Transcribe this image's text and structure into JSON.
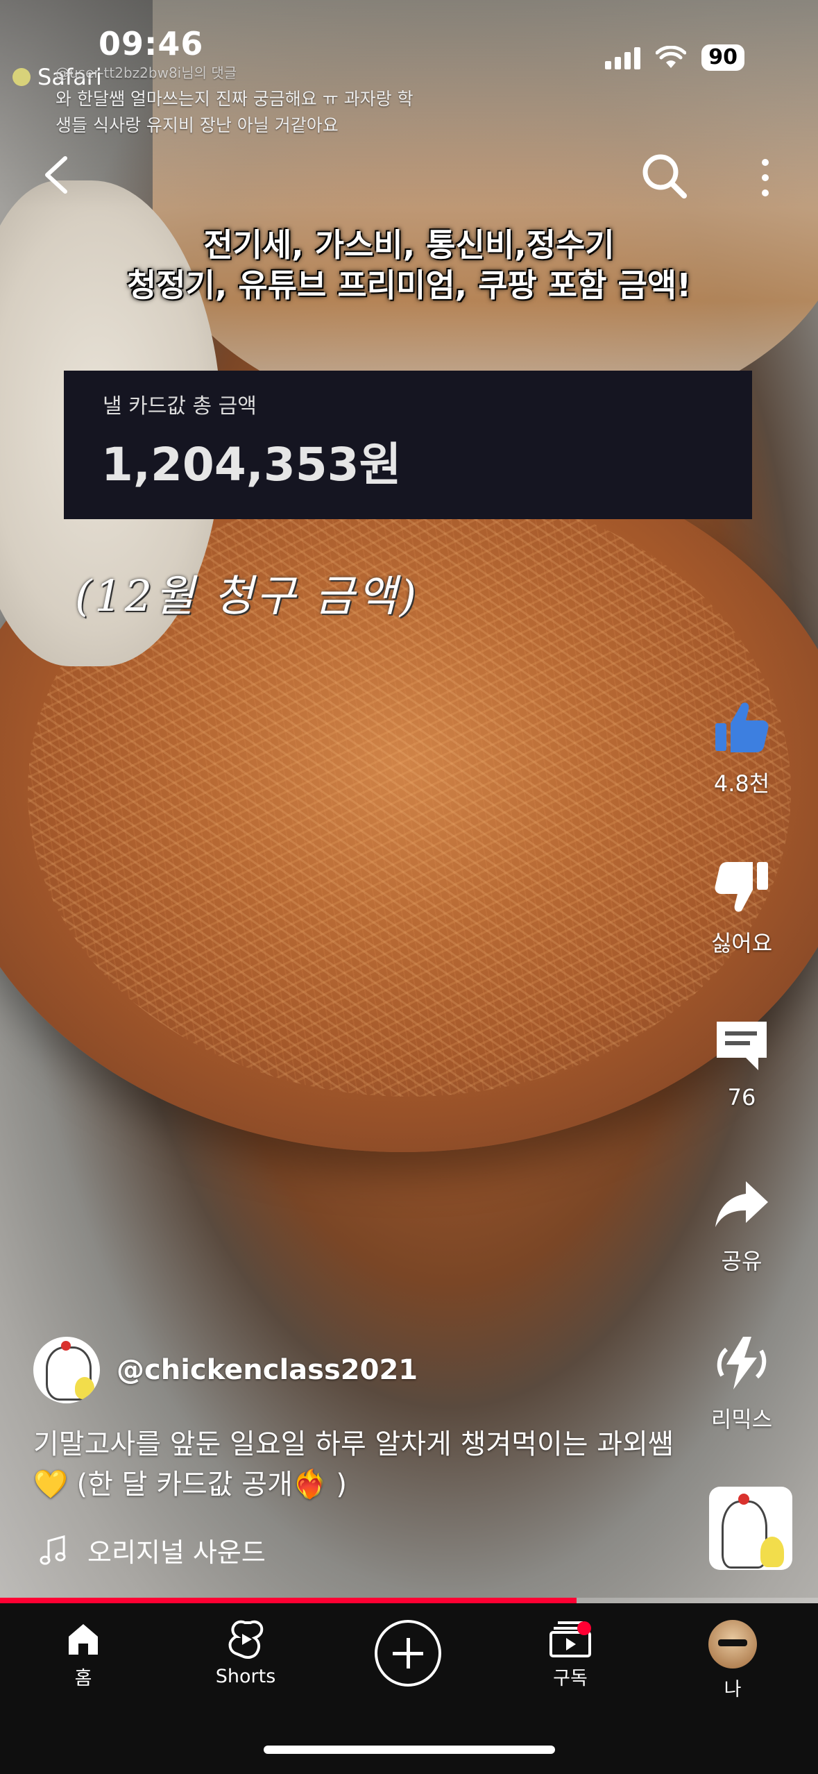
{
  "status": {
    "time": "09:46",
    "battery": "90",
    "back_app": "Safari"
  },
  "comment_overlay": {
    "user": "@user-tt2bz2bw8i님의 댓글",
    "text": "와 한달쌤 얼마쓰는지 진짜 궁금해요 ㅠ 과자랑 학생들 식사랑 유지비 장난 아닐 거같아요"
  },
  "video": {
    "caption_line1": "전기세, 가스비, 통신비,정수기",
    "caption_line2": "청정기, 유튜브 프리미엄, 쿠팡 포함 금액!",
    "card_label": "낼 카드값 총 금액",
    "card_amount": "1,204,353원",
    "handwritten": "(12월 청구 금액)",
    "progress_fraction": 0.705
  },
  "actions": {
    "like_count": "4.8천",
    "dislike_label": "싫어요",
    "comment_count": "76",
    "share_label": "공유",
    "remix_label": "리믹스"
  },
  "channel": {
    "name": "@chickenclass2021"
  },
  "title": {
    "text": "기말고사를 앞둔 일요일 하루 알차게 챙겨먹이는 과외쌤💛 (한 달 카드값 공개❤️‍🔥 )"
  },
  "sound": {
    "label": "오리지널 사운드"
  },
  "bottom_nav": {
    "home": "홈",
    "shorts": "Shorts",
    "subscriptions": "구독",
    "me": "나"
  },
  "colors": {
    "accent_red": "#ff0033",
    "like_blue": "#3d7fe0",
    "nav_bg": "#0f0f0f"
  }
}
